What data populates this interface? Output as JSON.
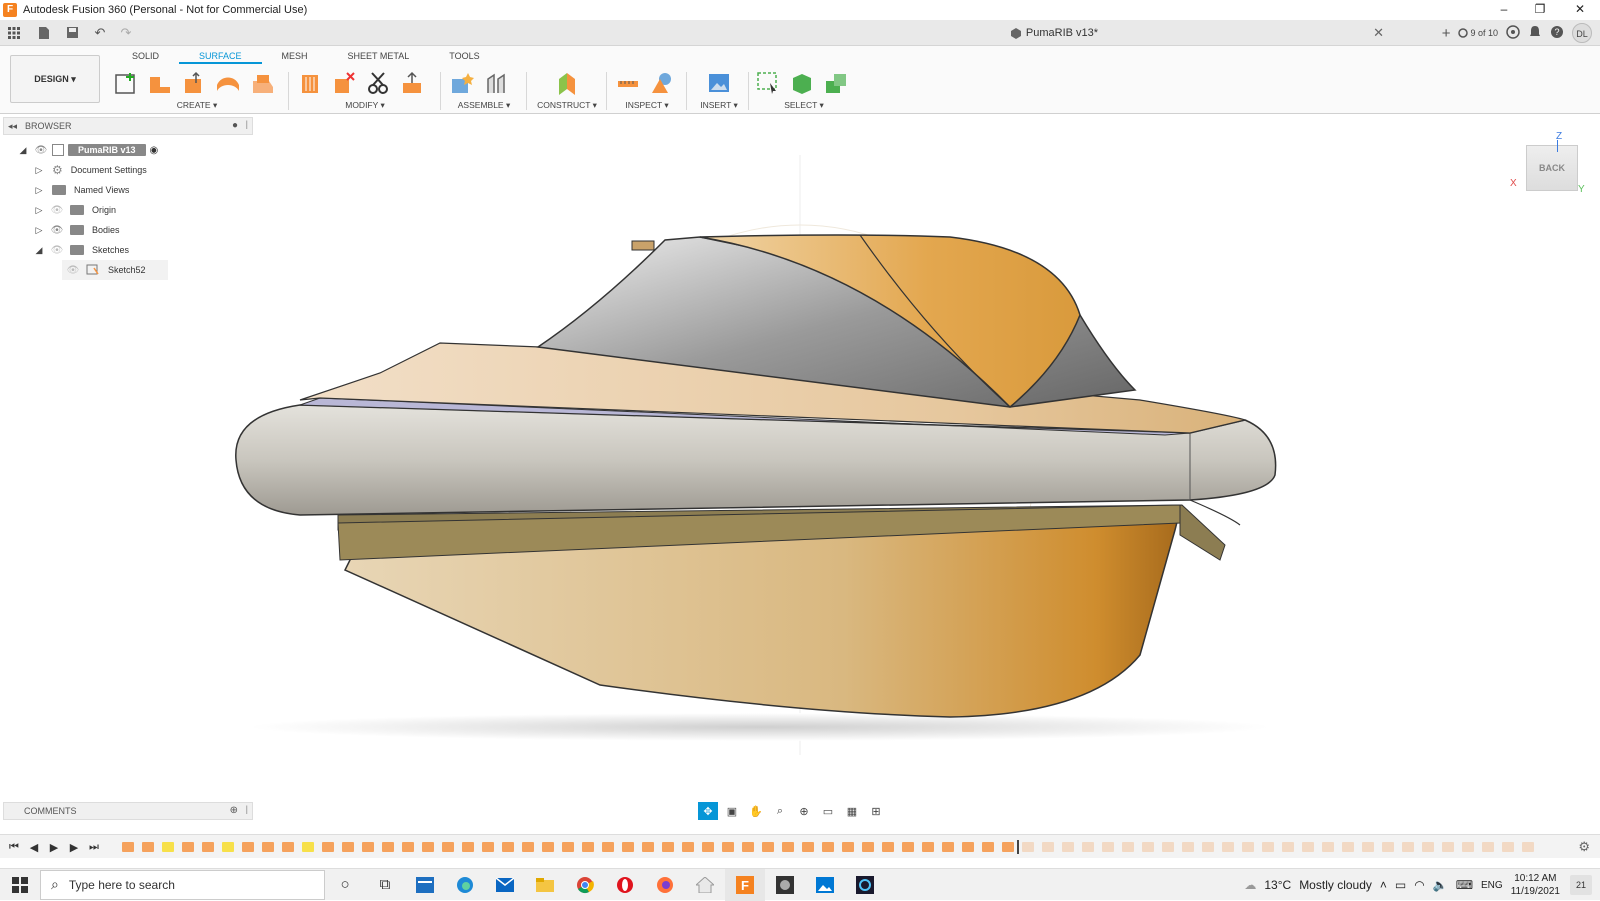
{
  "window": {
    "title": "Autodesk Fusion 360 (Personal - Not for Commercial Use)",
    "app_logo_letter": "F",
    "minimize": "–",
    "restore": "❐",
    "close": "✕"
  },
  "tabbar": {
    "doc_title": "PumaRIB v13*",
    "close": "✕",
    "version_count": "9 of 10",
    "user_initials": "DL"
  },
  "ribbon": {
    "workspace": "DESIGN ▾",
    "tabs": [
      {
        "label": "SOLID"
      },
      {
        "label": "SURFACE"
      },
      {
        "label": "MESH"
      },
      {
        "label": "SHEET METAL"
      },
      {
        "label": "TOOLS"
      }
    ],
    "groups": {
      "create": "CREATE ▾",
      "modify": "MODIFY ▾",
      "assemble": "ASSEMBLE ▾",
      "construct": "CONSTRUCT ▾",
      "inspect": "INSPECT ▾",
      "insert": "INSERT ▾",
      "select": "SELECT ▾"
    }
  },
  "browser": {
    "header": "BROWSER",
    "root": "PumaRIB v13",
    "items": [
      {
        "label": "Document Settings"
      },
      {
        "label": "Named Views"
      },
      {
        "label": "Origin"
      },
      {
        "label": "Bodies"
      },
      {
        "label": "Sketches"
      },
      {
        "label": "Sketch52"
      }
    ]
  },
  "viewcube": {
    "face": "BACK",
    "axis_z": "Z",
    "axis_x": "X",
    "axis_y": "Y"
  },
  "comments": {
    "header": "COMMENTS"
  },
  "taskbar": {
    "search_placeholder": "Type here to search",
    "weather_temp": "13°C",
    "weather_text": "Mostly cloudy",
    "language": "ENG",
    "time": "10:12 AM",
    "date": "11/19/2021",
    "notifications": "21"
  },
  "colors": {
    "accent": "#0696d7",
    "hull_orange": "#e0a04a",
    "tube_grey": "#c8c6c0"
  }
}
